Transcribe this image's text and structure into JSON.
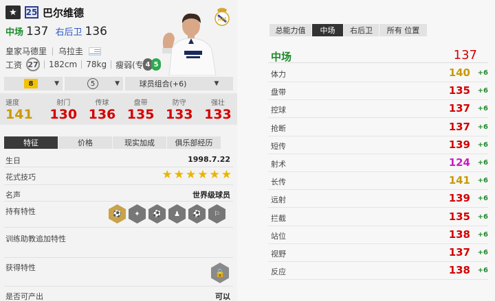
{
  "header": {
    "number": "25",
    "name": "巴尔维德",
    "position_main": "中场",
    "position_main_value": "137",
    "position_alt": "右后卫",
    "position_alt_value": "136",
    "club": "皇家马德里",
    "nationality": "乌拉圭",
    "wage_label": "工资",
    "wage": "27",
    "height": "182cm",
    "weight": "78kg",
    "weak_foot": "瘦弱(专属)",
    "left_foot": "4",
    "right_foot": "5"
  },
  "selectors": {
    "level": "8",
    "boost": "5",
    "combo": "球员组合(+6)"
  },
  "stats": [
    {
      "label": "速度",
      "value": "141",
      "color": "#c99a00"
    },
    {
      "label": "射门",
      "value": "130",
      "color": "#d40000"
    },
    {
      "label": "传球",
      "value": "136",
      "color": "#d40000"
    },
    {
      "label": "盘带",
      "value": "135",
      "color": "#d40000"
    },
    {
      "label": "防守",
      "value": "133",
      "color": "#d40000"
    },
    {
      "label": "强壮",
      "value": "133",
      "color": "#d40000"
    }
  ],
  "tabs": [
    "特征",
    "价格",
    "现实加成",
    "俱乐部经历"
  ],
  "details": {
    "birthday_label": "生日",
    "birthday": "1998.7.22",
    "skill_label": "花式技巧",
    "skill_stars": 6,
    "fame_label": "名声",
    "fame": "世界级球员",
    "traits_label": "持有特性",
    "trait_icons": [
      "ball-trait-icon",
      "trait-icon-2",
      "trait-icon-3",
      "trait-icon-4",
      "trait-icon-5",
      "trait-icon-6"
    ],
    "coach_label": "训练助教追加特性",
    "acquired_label": "获得特性",
    "sellable_label": "是否可产出",
    "sellable": "可以"
  },
  "right_tabs": [
    "总能力值",
    "中场",
    "右后卫",
    "所有 位置"
  ],
  "position_summary": {
    "label": "中场",
    "value": "137"
  },
  "attributes": [
    {
      "label": "体力",
      "value": "140",
      "bonus": "+6",
      "color": "#c99a00"
    },
    {
      "label": "盘带",
      "value": "135",
      "bonus": "+6",
      "color": "#d40000"
    },
    {
      "label": "控球",
      "value": "137",
      "bonus": "+6",
      "color": "#d40000"
    },
    {
      "label": "抢断",
      "value": "137",
      "bonus": "+6",
      "color": "#d40000"
    },
    {
      "label": "短传",
      "value": "139",
      "bonus": "+6",
      "color": "#d40000"
    },
    {
      "label": "射术",
      "value": "124",
      "bonus": "+6",
      "color": "#c71fc2"
    },
    {
      "label": "长传",
      "value": "141",
      "bonus": "+6",
      "color": "#c99a00"
    },
    {
      "label": "远射",
      "value": "139",
      "bonus": "+6",
      "color": "#d40000"
    },
    {
      "label": "拦截",
      "value": "135",
      "bonus": "+6",
      "color": "#d40000"
    },
    {
      "label": "站位",
      "value": "138",
      "bonus": "+6",
      "color": "#d40000"
    },
    {
      "label": "视野",
      "value": "137",
      "bonus": "+6",
      "color": "#d40000"
    },
    {
      "label": "反应",
      "value": "138",
      "bonus": "+6",
      "color": "#d40000"
    }
  ]
}
